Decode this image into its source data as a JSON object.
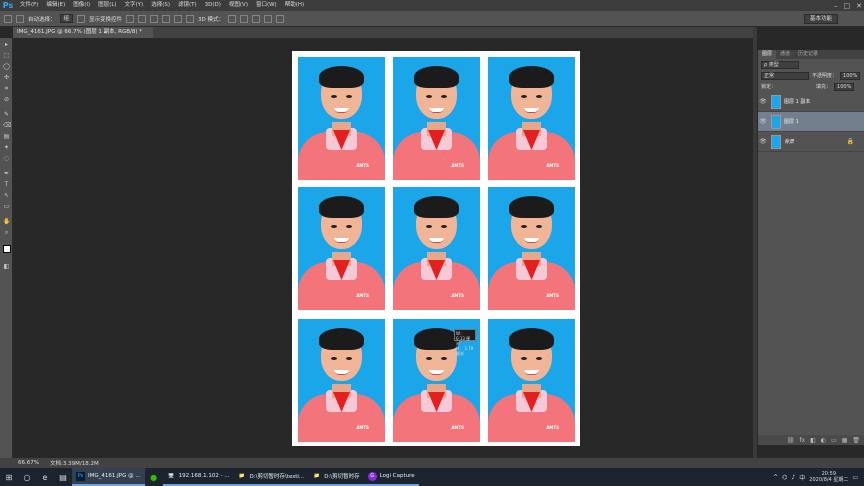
{
  "app": {
    "logo": "Ps",
    "menus": [
      "文件(F)",
      "编辑(E)",
      "图像(I)",
      "图层(L)",
      "文字(Y)",
      "选择(S)",
      "滤镜(T)",
      "3D(D)",
      "视图(V)",
      "窗口(W)",
      "帮助(H)"
    ],
    "window_controls": [
      "–",
      "□",
      "✕"
    ]
  },
  "options_bar": {
    "auto_select_label": "自动选择：",
    "auto_select_value": "组",
    "transform_label": "显示变换控件",
    "mode_3d_label": "3D 模式：",
    "workspace": "基本功能"
  },
  "document": {
    "tab_title": "IMG_4161.JPG @ 66.7% (图层 1 副本, RGB/8) *",
    "photo_logo": "AMTS",
    "measure_tip": {
      "w": "W：  0.13 厘米",
      "h": "H：  3.79 厘米"
    }
  },
  "tools": [
    "▸",
    "⬚",
    "◯",
    "✣",
    "⌗",
    "⊘",
    "✎",
    "⌫",
    "▤",
    "✦",
    "◌",
    "✒",
    "T",
    "↖",
    "▭",
    "✋",
    "⌕",
    "◧"
  ],
  "layers_panel": {
    "tabs": [
      "图层",
      "通道",
      "历史记录"
    ],
    "filter_label": "ρ 类型",
    "blend_mode": "正常",
    "opacity_label": "不透明度：",
    "opacity_value": "100%",
    "lock_label": "锁定：",
    "fill_label": "填充：",
    "fill_value": "100%",
    "layers": [
      {
        "name": "图层 1 副本",
        "selected": false,
        "locked": false
      },
      {
        "name": "图层 1",
        "selected": true,
        "locked": false
      },
      {
        "name": "背景",
        "selected": false,
        "locked": true
      }
    ],
    "footer_icons": [
      "⛓",
      "fx",
      "◧",
      "◐",
      "▭",
      "▦",
      "🗑"
    ]
  },
  "status": {
    "zoom": "66.67%",
    "doc_size": "文档:3.39M/18.2M"
  },
  "taskbar": {
    "apps": [
      {
        "icon": "Ps",
        "label": "IMG_4161.JPG @ ..."
      },
      {
        "icon": "🖥",
        "label": "192.168.1.102 - ..."
      },
      {
        "icon": "📁",
        "label": "D:\\剪切暂时存\\testi..."
      },
      {
        "icon": "📁",
        "label": "D:\\剪切暂时存"
      },
      {
        "icon": "G",
        "label": "Logi Capture"
      }
    ],
    "time": "20:59",
    "date": "2020/8/4 星期二"
  }
}
